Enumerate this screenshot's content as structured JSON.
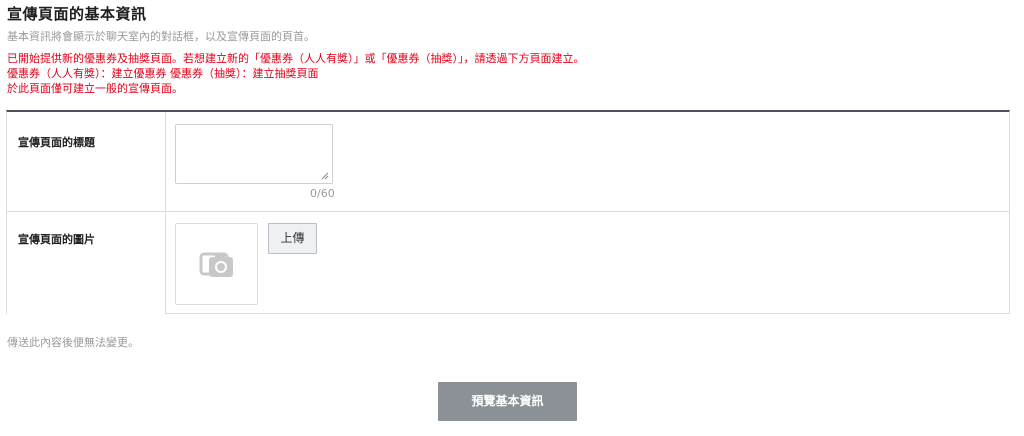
{
  "header": {
    "title": "宣傳頁面的基本資訊",
    "subtitle": "基本資訊將會顯示於聊天室內的對話框，以及宣傳頁面的頁首。"
  },
  "notice": {
    "line1": "已開始提供新的優惠券及抽獎頁面。若想建立新的「優惠券（人人有獎）」或「優惠券（抽獎）」，請透過下方頁面建立。",
    "line2": "優惠券（人人有獎）：建立優惠券 優惠券（抽獎）：建立抽獎頁面",
    "line3": "於此頁面僅可建立一般的宣傳頁面。",
    "color": "#e1001a"
  },
  "form": {
    "title_row": {
      "label": "宣傳頁面的標題",
      "value": "",
      "counter": "0/60"
    },
    "image_row": {
      "label": "宣傳頁面的圖片",
      "placeholder_icon": "camera-icon",
      "upload_label": "上傳"
    }
  },
  "footer": {
    "note": "傳送此內容後便無法變更。",
    "preview_label": "預覽基本資訊"
  },
  "colors": {
    "table_top_border": "#4f4f5e",
    "preview_button": "#8c9097"
  }
}
